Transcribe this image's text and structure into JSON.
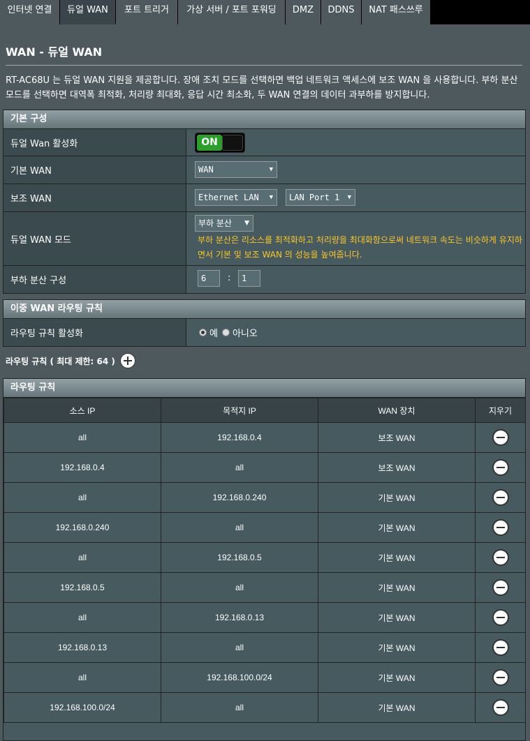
{
  "tabs": [
    "인터넷 연결",
    "듀얼 WAN",
    "포트 트리거",
    "가상 서버 / 포트 포워딩",
    "DMZ",
    "DDNS",
    "NAT 패스쓰루"
  ],
  "page_title": "WAN - 듀얼 WAN",
  "description": "RT-AC68U 는 듀얼 WAN 지원을 제공합니다. 장애 조치 모드를 선택하면 백업 네트워크 액세스에 보조 WAN 을 사용합니다. 부하 분산 모드를 선택하면 대역폭 최적화, 처리량 최대화, 응답 시간 최소화, 두 WAN 연결의 데이터 과부하를 방지합니다.",
  "basic": {
    "header": "기본 구성",
    "dual_wan_label": "듀얼 Wan 활성화",
    "toggle": "ON",
    "primary_label": "기본 WAN",
    "primary_value": "WAN",
    "secondary_label": "보조 WAN",
    "secondary_value": "Ethernet LAN",
    "secondary_port": "LAN Port 1",
    "mode_label": "듀얼 WAN 모드",
    "mode_value": "부하 분산",
    "mode_note": "부하 분산은 리소스를 최적화하고 처리량을 최대화함으로써 네트워크 속도는 비슷하게 유지하면서 기본 및 보조 WAN 의 성능을 높여줍니다.",
    "lb_label": "부하 분산 구성",
    "lb_primary": "6",
    "lb_sep": ":",
    "lb_secondary": "1"
  },
  "routing": {
    "header": "이중 WAN 라우팅 규칙",
    "enable_label": "라우팅 규칙 활성화",
    "yes": "예",
    "no": "아니오",
    "selected": "yes"
  },
  "rules_limit": "라우팅 규칙 ( 최대 제한: 64 )",
  "rules": {
    "header": "라우팅 규칙",
    "columns": [
      "소스 IP",
      "목적지 IP",
      "WAN 장치",
      "지우기"
    ],
    "rows": [
      [
        "all",
        "192.168.0.4",
        "보조 WAN"
      ],
      [
        "192.168.0.4",
        "all",
        "보조 WAN"
      ],
      [
        "all",
        "192.168.0.240",
        "기본 WAN"
      ],
      [
        "192.168.0.240",
        "all",
        "기본 WAN"
      ],
      [
        "all",
        "192.168.0.5",
        "기본 WAN"
      ],
      [
        "192.168.0.5",
        "all",
        "기본 WAN"
      ],
      [
        "all",
        "192.168.0.13",
        "기본 WAN"
      ],
      [
        "192.168.0.13",
        "all",
        "기본 WAN"
      ],
      [
        "all",
        "192.168.100.0/24",
        "기본 WAN"
      ],
      [
        "192.168.100.0/24",
        "all",
        "기본 WAN"
      ]
    ]
  }
}
